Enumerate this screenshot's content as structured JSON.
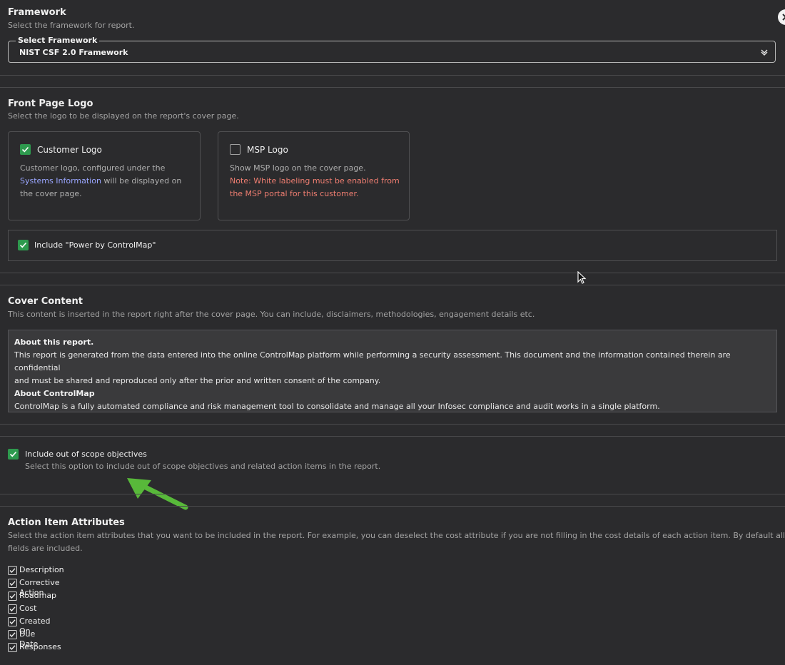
{
  "framework": {
    "title": "Framework",
    "description": "Select the framework for report.",
    "select_label": "Select Framework",
    "select_value": "NIST CSF 2.0 Framework"
  },
  "logo": {
    "title": "Front Page Logo",
    "description": "Select the logo to be displayed on the report's cover page.",
    "customer": {
      "label": "Customer Logo",
      "checked": true,
      "text_before": "Customer logo, configured under the",
      "link": "Systems Information",
      "text_after": "will be displayed on",
      "text_last": "the cover page."
    },
    "msp": {
      "label": "MSP Logo",
      "checked": false,
      "text": "Show MSP logo on the cover page.",
      "note_line1": "Note: White labeling must be enabled from",
      "note_line2": "the MSP portal for this customer."
    },
    "powered_by": {
      "label": "Include \"Power by ControlMap\"",
      "checked": true
    }
  },
  "cover": {
    "title": "Cover Content",
    "description": "This content is inserted in the report right after the cover page. You can include, disclaimers, methodologies, engagement details etc.",
    "about_report_heading": "About this report.",
    "about_report_line1": "This report is generated from the data entered into the online ControlMap platform while performing a security assessment. This document and the information contained therein are confidential",
    "about_report_line2": "and must be shared and reproduced only after the prior and written consent of the company.",
    "about_cm_heading": "About ControlMap",
    "about_cm_text": "ControlMap is a fully automated compliance and risk management tool to consolidate and manage all your Infosec compliance and audit works in a single platform."
  },
  "scope": {
    "label": "Include out of scope objectives",
    "checked": true,
    "description": "Select this option to include out of scope objectives and related action items in the report."
  },
  "attributes": {
    "title": "Action Item Attributes",
    "description_line1": "Select the action item attributes that you want to be included in the report. For example, you can deselect the cost attribute if you are not filling in the cost details of each action item. By default all",
    "description_line2": "fields are included.",
    "items": [
      "Description",
      "Corrective Action",
      "Roadmap",
      "Cost",
      "Created On",
      "Due Date",
      "Responses"
    ]
  },
  "colors": {
    "background": "#2b2b2d",
    "checkbox_green": "#2e9a4e",
    "link": "#9aa6ff",
    "warning": "#ef7e71",
    "arrow": "#58b93a"
  }
}
